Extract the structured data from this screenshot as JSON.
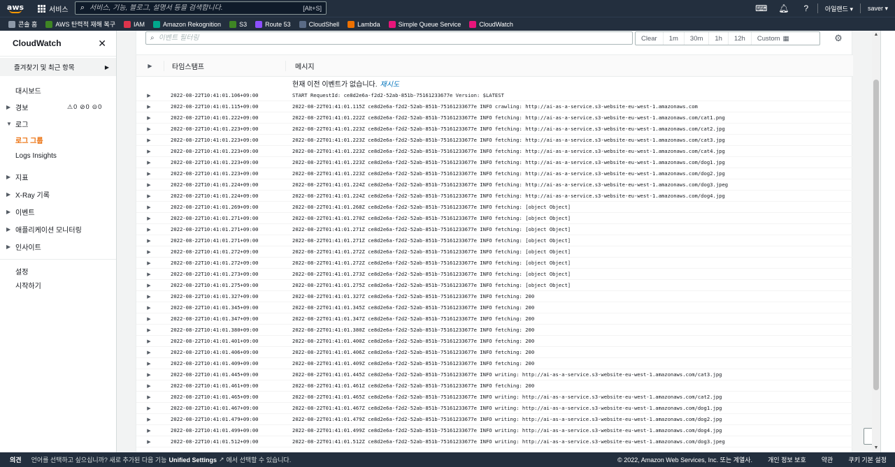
{
  "topnav": {
    "logo": "aws",
    "services_label": "서비스",
    "search_placeholder": "서비스, 기능, 블로그, 설명서 등을 검색합니다.",
    "search_shortcut": "[Alt+S]",
    "region": "아일랜드 ▾",
    "user": "saver ▾"
  },
  "favbar": {
    "items": [
      {
        "label": "콘솔 홈",
        "color": "#8d99a8"
      },
      {
        "label": "AWS 탄력적 재해 복구",
        "color": "#3f8624"
      },
      {
        "label": "IAM",
        "color": "#dd344c"
      },
      {
        "label": "Amazon Rekognition",
        "color": "#01a88d"
      },
      {
        "label": "S3",
        "color": "#3f8624"
      },
      {
        "label": "Route 53",
        "color": "#8c4fff"
      },
      {
        "label": "CloudShell",
        "color": "#5a6b86"
      },
      {
        "label": "Lambda",
        "color": "#ed7100"
      },
      {
        "label": "Simple Queue Service",
        "color": "#e7157b"
      },
      {
        "label": "CloudWatch",
        "color": "#e7157b"
      }
    ]
  },
  "sidebar": {
    "title": "CloudWatch",
    "favorites": "즐겨찾기 및 최근 항목",
    "dashboard": "대시보드",
    "alarms": "경보",
    "alarm_counts": [
      "0",
      "0",
      "0"
    ],
    "logs": "로그",
    "log_groups": "로그 그룹",
    "logs_insights": "Logs Insights",
    "metrics": "지표",
    "xray": "X-Ray 기록",
    "events": "이벤트",
    "app_monitoring": "애플리케이션 모니터링",
    "insights": "인사이트",
    "settings": "설정",
    "getting_started": "시작하기"
  },
  "toolbar": {
    "filter_placeholder": "이벤트 필터링",
    "clear": "Clear",
    "range_1m": "1m",
    "range_30m": "30m",
    "range_1h": "1h",
    "range_12h": "12h",
    "custom": "Custom"
  },
  "table": {
    "col_timestamp": "타임스탬프",
    "col_message": "메시지",
    "no_older_events": "현재 이전 이벤트가 없습니다.",
    "retry": "재시도",
    "rows": [
      {
        "ts": "2022-08-22T10:41:01.106+09:00",
        "msg": "START RequestId: ce8d2e6a-f2d2-52ab-851b-75161233677e Version: $LATEST"
      },
      {
        "ts": "2022-08-22T10:41:01.115+09:00",
        "msg": "2022-08-22T01:41:01.115Z ce8d2e6a-f2d2-52ab-851b-75161233677e INFO crawling: http://ai-as-a-service.s3-website-eu-west-1.amazonaws.com"
      },
      {
        "ts": "2022-08-22T10:41:01.222+09:00",
        "msg": "2022-08-22T01:41:01.222Z ce8d2e6a-f2d2-52ab-851b-75161233677e INFO fetching: http://ai-as-a-service.s3-website-eu-west-1.amazonaws.com/cat1.png"
      },
      {
        "ts": "2022-08-22T10:41:01.223+09:00",
        "msg": "2022-08-22T01:41:01.223Z ce8d2e6a-f2d2-52ab-851b-75161233677e INFO fetching: http://ai-as-a-service.s3-website-eu-west-1.amazonaws.com/cat2.jpg"
      },
      {
        "ts": "2022-08-22T10:41:01.223+09:00",
        "msg": "2022-08-22T01:41:01.223Z ce8d2e6a-f2d2-52ab-851b-75161233677e INFO fetching: http://ai-as-a-service.s3-website-eu-west-1.amazonaws.com/cat3.jpg"
      },
      {
        "ts": "2022-08-22T10:41:01.223+09:00",
        "msg": "2022-08-22T01:41:01.223Z ce8d2e6a-f2d2-52ab-851b-75161233677e INFO fetching: http://ai-as-a-service.s3-website-eu-west-1.amazonaws.com/cat4.jpg"
      },
      {
        "ts": "2022-08-22T10:41:01.223+09:00",
        "msg": "2022-08-22T01:41:01.223Z ce8d2e6a-f2d2-52ab-851b-75161233677e INFO fetching: http://ai-as-a-service.s3-website-eu-west-1.amazonaws.com/dog1.jpg"
      },
      {
        "ts": "2022-08-22T10:41:01.223+09:00",
        "msg": "2022-08-22T01:41:01.223Z ce8d2e6a-f2d2-52ab-851b-75161233677e INFO fetching: http://ai-as-a-service.s3-website-eu-west-1.amazonaws.com/dog2.jpg"
      },
      {
        "ts": "2022-08-22T10:41:01.224+09:00",
        "msg": "2022-08-22T01:41:01.224Z ce8d2e6a-f2d2-52ab-851b-75161233677e INFO fetching: http://ai-as-a-service.s3-website-eu-west-1.amazonaws.com/dog3.jpeg"
      },
      {
        "ts": "2022-08-22T10:41:01.224+09:00",
        "msg": "2022-08-22T01:41:01.224Z ce8d2e6a-f2d2-52ab-851b-75161233677e INFO fetching: http://ai-as-a-service.s3-website-eu-west-1.amazonaws.com/dog4.jpg"
      },
      {
        "ts": "2022-08-22T10:41:01.269+09:00",
        "msg": "2022-08-22T01:41:01.268Z ce8d2e6a-f2d2-52ab-851b-75161233677e INFO fetching: [object Object]"
      },
      {
        "ts": "2022-08-22T10:41:01.271+09:00",
        "msg": "2022-08-22T01:41:01.270Z ce8d2e6a-f2d2-52ab-851b-75161233677e INFO fetching: [object Object]"
      },
      {
        "ts": "2022-08-22T10:41:01.271+09:00",
        "msg": "2022-08-22T01:41:01.271Z ce8d2e6a-f2d2-52ab-851b-75161233677e INFO fetching: [object Object]"
      },
      {
        "ts": "2022-08-22T10:41:01.271+09:00",
        "msg": "2022-08-22T01:41:01.271Z ce8d2e6a-f2d2-52ab-851b-75161233677e INFO fetching: [object Object]"
      },
      {
        "ts": "2022-08-22T10:41:01.272+09:00",
        "msg": "2022-08-22T01:41:01.272Z ce8d2e6a-f2d2-52ab-851b-75161233677e INFO fetching: [object Object]"
      },
      {
        "ts": "2022-08-22T10:41:01.272+09:00",
        "msg": "2022-08-22T01:41:01.272Z ce8d2e6a-f2d2-52ab-851b-75161233677e INFO fetching: [object Object]"
      },
      {
        "ts": "2022-08-22T10:41:01.273+09:00",
        "msg": "2022-08-22T01:41:01.273Z ce8d2e6a-f2d2-52ab-851b-75161233677e INFO fetching: [object Object]"
      },
      {
        "ts": "2022-08-22T10:41:01.275+09:00",
        "msg": "2022-08-22T01:41:01.275Z ce8d2e6a-f2d2-52ab-851b-75161233677e INFO fetching: [object Object]"
      },
      {
        "ts": "2022-08-22T10:41:01.327+09:00",
        "msg": "2022-08-22T01:41:01.327Z ce8d2e6a-f2d2-52ab-851b-75161233677e INFO fetching: 200"
      },
      {
        "ts": "2022-08-22T10:41:01.345+09:00",
        "msg": "2022-08-22T01:41:01.345Z ce8d2e6a-f2d2-52ab-851b-75161233677e INFO fetching: 200"
      },
      {
        "ts": "2022-08-22T10:41:01.347+09:00",
        "msg": "2022-08-22T01:41:01.347Z ce8d2e6a-f2d2-52ab-851b-75161233677e INFO fetching: 200"
      },
      {
        "ts": "2022-08-22T10:41:01.380+09:00",
        "msg": "2022-08-22T01:41:01.380Z ce8d2e6a-f2d2-52ab-851b-75161233677e INFO fetching: 200"
      },
      {
        "ts": "2022-08-22T10:41:01.401+09:00",
        "msg": "2022-08-22T01:41:01.400Z ce8d2e6a-f2d2-52ab-851b-75161233677e INFO fetching: 200"
      },
      {
        "ts": "2022-08-22T10:41:01.406+09:00",
        "msg": "2022-08-22T01:41:01.406Z ce8d2e6a-f2d2-52ab-851b-75161233677e INFO fetching: 200"
      },
      {
        "ts": "2022-08-22T10:41:01.409+09:00",
        "msg": "2022-08-22T01:41:01.409Z ce8d2e6a-f2d2-52ab-851b-75161233677e INFO fetching: 200"
      },
      {
        "ts": "2022-08-22T10:41:01.445+09:00",
        "msg": "2022-08-22T01:41:01.445Z ce8d2e6a-f2d2-52ab-851b-75161233677e INFO writing: http://ai-as-a-service.s3-website-eu-west-1.amazonaws.com/cat3.jpg"
      },
      {
        "ts": "2022-08-22T10:41:01.461+09:00",
        "msg": "2022-08-22T01:41:01.461Z ce8d2e6a-f2d2-52ab-851b-75161233677e INFO fetching: 200"
      },
      {
        "ts": "2022-08-22T10:41:01.465+09:00",
        "msg": "2022-08-22T01:41:01.465Z ce8d2e6a-f2d2-52ab-851b-75161233677e INFO writing: http://ai-as-a-service.s3-website-eu-west-1.amazonaws.com/cat2.jpg"
      },
      {
        "ts": "2022-08-22T10:41:01.467+09:00",
        "msg": "2022-08-22T01:41:01.467Z ce8d2e6a-f2d2-52ab-851b-75161233677e INFO writing: http://ai-as-a-service.s3-website-eu-west-1.amazonaws.com/dog1.jpg"
      },
      {
        "ts": "2022-08-22T10:41:01.479+09:00",
        "msg": "2022-08-22T01:41:01.479Z ce8d2e6a-f2d2-52ab-851b-75161233677e INFO writing: http://ai-as-a-service.s3-website-eu-west-1.amazonaws.com/dog2.jpg"
      },
      {
        "ts": "2022-08-22T10:41:01.499+09:00",
        "msg": "2022-08-22T01:41:01.499Z ce8d2e6a-f2d2-52ab-851b-75161233677e INFO writing: http://ai-as-a-service.s3-website-eu-west-1.amazonaws.com/dog4.jpg"
      },
      {
        "ts": "2022-08-22T10:41:01.512+09:00",
        "msg": "2022-08-22T01:41:01.512Z ce8d2e6a-f2d2-52ab-851b-75161233677e INFO writing: http://ai-as-a-service.s3-website-eu-west-1.amazonaws.com/dog3.jpeg"
      }
    ]
  },
  "footer": {
    "feedback": "의견",
    "lang_prefix": "언어를 선택하고 싶으십니까? 새로 추가된 다음 기능",
    "lang_link": "Unified Settings",
    "lang_suffix": "에서 선택할 수 있습니다.",
    "copyright": "© 2022, Amazon Web Services, Inc. 또는 계열사.",
    "privacy": "개인 정보 보호",
    "terms": "약관",
    "cookies": "쿠키 기본 설정"
  }
}
